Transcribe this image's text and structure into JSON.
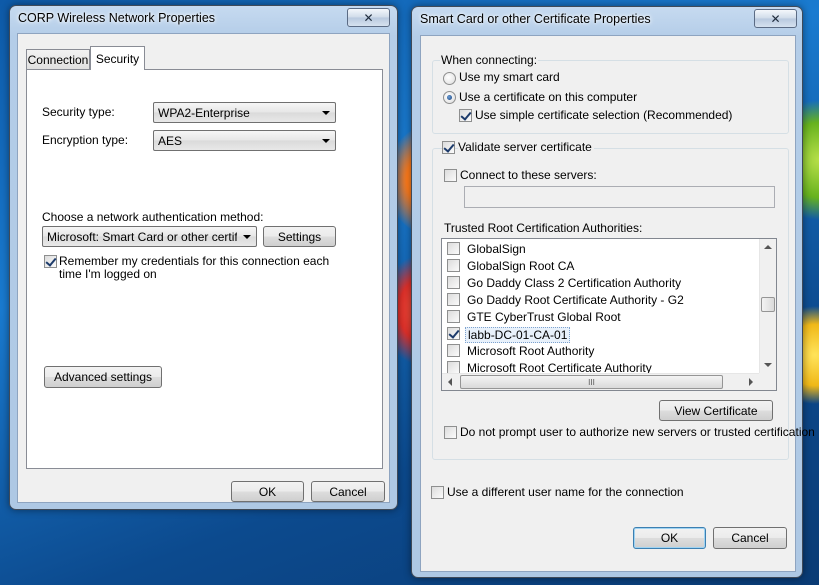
{
  "left_window": {
    "title": "CORP Wireless Network Properties",
    "close_glyph": "✕",
    "tabs": [
      {
        "label": "Connection",
        "active": false
      },
      {
        "label": "Security",
        "active": true
      }
    ],
    "security_type_label": "Security type:",
    "security_type_value": "WPA2-Enterprise",
    "encryption_type_label": "Encryption type:",
    "encryption_type_value": "AES",
    "auth_method_label": "Choose a network authentication method:",
    "auth_method_value": "Microsoft: Smart Card or other certificat",
    "settings_button": "Settings",
    "remember_credentials_line1": "Remember my credentials for this connection each",
    "remember_credentials_line2": "time I'm logged on",
    "remember_credentials_checked": true,
    "advanced_settings_button": "Advanced settings",
    "ok_button": "OK",
    "cancel_button": "Cancel"
  },
  "right_window": {
    "title": "Smart Card or other Certificate Properties",
    "close_glyph": "✕",
    "when_connecting_label": "When connecting:",
    "use_smart_card_label": "Use my smart card",
    "use_smart_card_selected": false,
    "use_certificate_label": "Use a certificate on this computer",
    "use_certificate_selected": true,
    "simple_cert_selection_label": "Use simple certificate selection (Recommended)",
    "simple_cert_selection_checked": true,
    "validate_server_label": "Validate server certificate",
    "validate_server_checked": true,
    "connect_to_servers_label": "Connect to these servers:",
    "connect_to_servers_checked": false,
    "servers_input_value": "",
    "trusted_root_label": "Trusted Root Certification Authorities:",
    "trusted_roots": [
      {
        "name": "GlobalSign",
        "checked": false,
        "selected": false
      },
      {
        "name": "GlobalSign Root CA",
        "checked": false,
        "selected": false
      },
      {
        "name": "Go Daddy Class 2 Certification Authority",
        "checked": false,
        "selected": false
      },
      {
        "name": "Go Daddy Root Certificate Authority - G2",
        "checked": false,
        "selected": false
      },
      {
        "name": "GTE CyberTrust Global Root",
        "checked": false,
        "selected": false
      },
      {
        "name": "labb-DC-01-CA-01",
        "checked": true,
        "selected": true
      },
      {
        "name": "Microsoft Root Authority",
        "checked": false,
        "selected": false
      },
      {
        "name": "Microsoft Root Certificate Authority",
        "checked": false,
        "selected": false
      }
    ],
    "hscroll_grip": "III",
    "view_certificate_button": "View Certificate",
    "do_not_prompt_label": "Do not prompt user to authorize new servers or trusted certification",
    "do_not_prompt_checked": false,
    "different_user_label": "Use a different user name for the connection",
    "different_user_checked": false,
    "ok_button": "OK",
    "cancel_button": "Cancel"
  },
  "colors": {
    "desktop_blue": "#1a7bd0",
    "window_frame": "#b4cde8",
    "dialog_face": "#f0f0f0",
    "accent_orange": "#ff7a1a",
    "accent_red": "#e0302a"
  }
}
